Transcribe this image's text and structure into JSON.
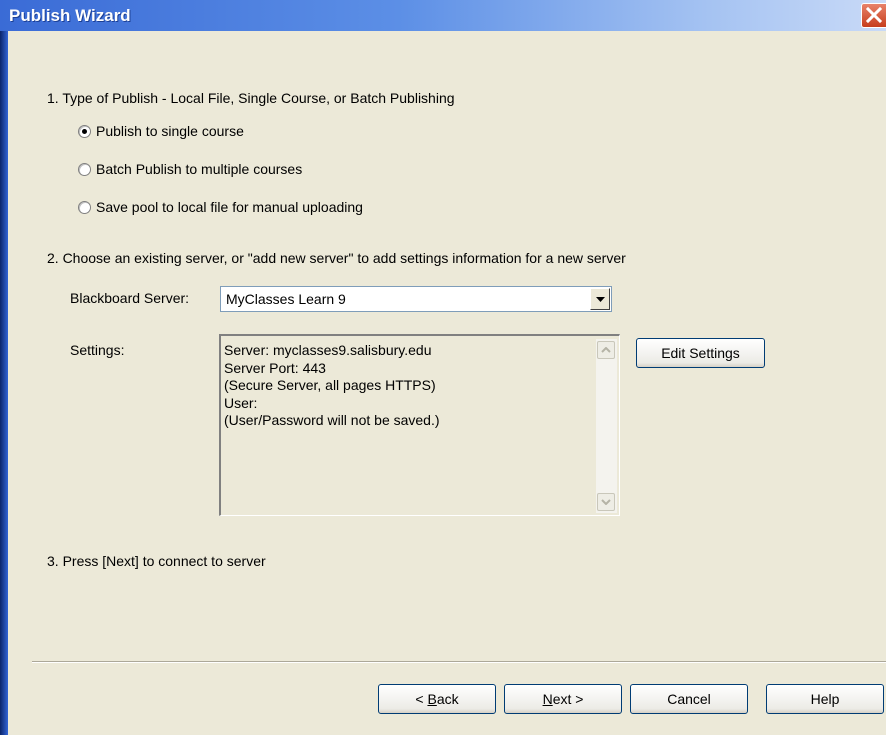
{
  "window": {
    "title": "Publish Wizard",
    "close_icon": "close-icon"
  },
  "step1": {
    "heading": "1. Type of Publish - Local File, Single Course, or Batch Publishing",
    "options": [
      {
        "label": "Publish to single course",
        "selected": true
      },
      {
        "label": "Batch Publish to multiple courses",
        "selected": false
      },
      {
        "label": "Save pool to local file for manual uploading",
        "selected": false
      }
    ]
  },
  "step2": {
    "heading": "2. Choose an existing server, or \"add new server\" to add settings information for a new server",
    "server_label": "Blackboard Server:",
    "server_value": "MyClasses Learn 9",
    "settings_label": "Settings:",
    "settings_lines": [
      "Server: myclasses9.salisbury.edu",
      "Server Port: 443",
      "(Secure Server, all pages HTTPS)",
      "User:",
      "(User/Password will not be saved.)"
    ],
    "edit_settings": "Edit Settings"
  },
  "step3": {
    "heading": "3. Press [Next] to connect to server"
  },
  "footer": {
    "back": {
      "prefix": "< ",
      "accel": "B",
      "rest": "ack"
    },
    "next": {
      "accel": "N",
      "rest": "ext >"
    },
    "cancel": "Cancel",
    "help": "Help"
  }
}
